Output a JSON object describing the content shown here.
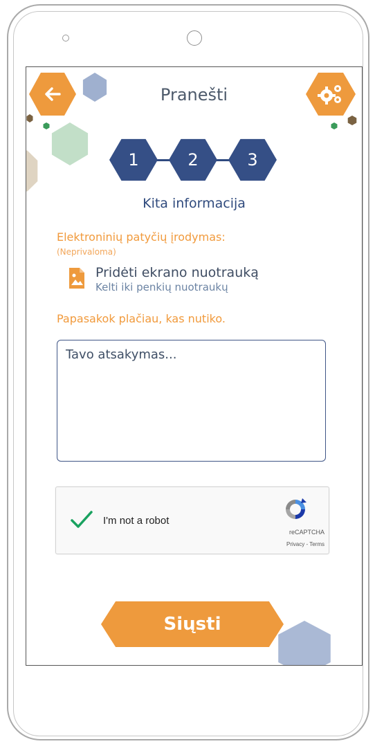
{
  "header": {
    "title": "Pranešti",
    "back_icon": "arrow-left-icon",
    "settings_icon": "gears-icon"
  },
  "stepper": {
    "steps": [
      "1",
      "2",
      "3"
    ],
    "current_step_label": "Kita informacija"
  },
  "evidence": {
    "label": "Elektroninių patyčių įrodymas:",
    "optional_note": "(Neprivaloma)",
    "add_title": "Pridėti ekrano nuotrauką",
    "add_subtitle": "Kelti iki penkių nuotraukų",
    "icon": "image-file-icon"
  },
  "story": {
    "label": "Papasakok plačiau, kas nutiko.",
    "placeholder": "Tavo atsakymas..."
  },
  "captcha": {
    "label": "I'm not a robot",
    "brand": "reCAPTCHA",
    "links": "Privacy - Terms",
    "checked": true
  },
  "submit": {
    "label": "Siųsti"
  },
  "colors": {
    "accent_orange": "#ee9a3d",
    "navy": "#354f86",
    "check_green": "#1aa260"
  }
}
